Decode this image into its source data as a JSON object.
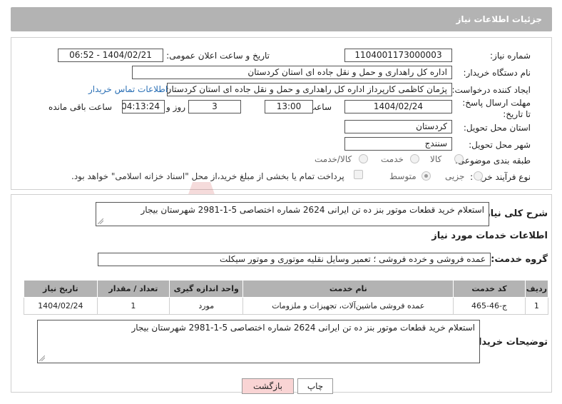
{
  "header": {
    "title": "جزئیات اطلاعات نیاز"
  },
  "form": {
    "need_number": {
      "label": "شماره نیاز:",
      "value": "1104001173000003"
    },
    "announce_datetime": {
      "label": "تاریخ و ساعت اعلان عمومی:",
      "value": "1404/02/21 - 06:52"
    },
    "buyer_org": {
      "label": "نام دستگاه خریدار:",
      "value": "اداره کل راهداری و حمل و نقل جاده ای استان کردستان"
    },
    "requester": {
      "label": "ایجاد کننده درخواست:",
      "value": "پژمان کاظمی کارپرداز اداره کل راهداری و حمل و نقل جاده ای استان کردستان",
      "contact_link": "اطلاعات تماس خریدار"
    },
    "deadline": {
      "label": "مهلت ارسال پاسخ: تا تاریخ:",
      "date": "1404/02/24",
      "time_label": "ساعت",
      "time": "13:00",
      "days": "3",
      "days_label": "روز و",
      "remaining": "04:13:24",
      "remaining_label": "ساعت باقی مانده"
    },
    "province": {
      "label": "استان محل تحویل:",
      "value": "کردستان"
    },
    "city": {
      "label": "شهر محل تحویل:",
      "value": "سنندج"
    },
    "category": {
      "label": "طبقه بندی موضوعی:",
      "options": [
        "کالا",
        "خدمت",
        "کالا/خدمت"
      ]
    },
    "process": {
      "label": "نوع فرآیند خرید :",
      "options": [
        "جزیی",
        "متوسط"
      ],
      "payment_note": "پرداخت تمام یا بخشی از مبلغ خرید،از محل \"اسناد خزانه اسلامی\" خواهد بود."
    }
  },
  "summary": {
    "label": "شرح کلی نیاز:",
    "value": "استعلام خرید قطعات موتور بنز ده تن ایرانی 2624 شماره اختصاصی 5-1-2981 شهرستان بیجار"
  },
  "services_info": {
    "title": "اطلاعات خدمات مورد نیاز",
    "group_label": "گروه خدمت:",
    "group_value": "عمده فروشی و خرده فروشی ؛ تعمیر وسایل نقلیه موتوری و موتور سیکلت"
  },
  "table": {
    "headers": [
      "ردیف",
      "کد خدمت",
      "نام خدمت",
      "واحد اندازه گیری",
      "تعداد / مقدار",
      "تاریخ نیاز"
    ],
    "rows": [
      [
        "1",
        "ج-46-465",
        "عمده فروشی ماشین‌آلات، تجهیزات و ملزومات",
        "مورد",
        "1",
        "1404/02/24"
      ]
    ]
  },
  "buyer_notes": {
    "label": "توضیحات خریدار:",
    "value": "استعلام خرید قطعات موتور بنز ده تن ایرانی 2624 شماره اختصاصی 5-1-2981 شهرستان بیجار"
  },
  "buttons": {
    "print": "چاپ",
    "back": "بازگشت"
  },
  "colors": {
    "header_bg": "#b3b3b3",
    "link": "#2a6fb5",
    "back_button": "#f9d4d4"
  }
}
